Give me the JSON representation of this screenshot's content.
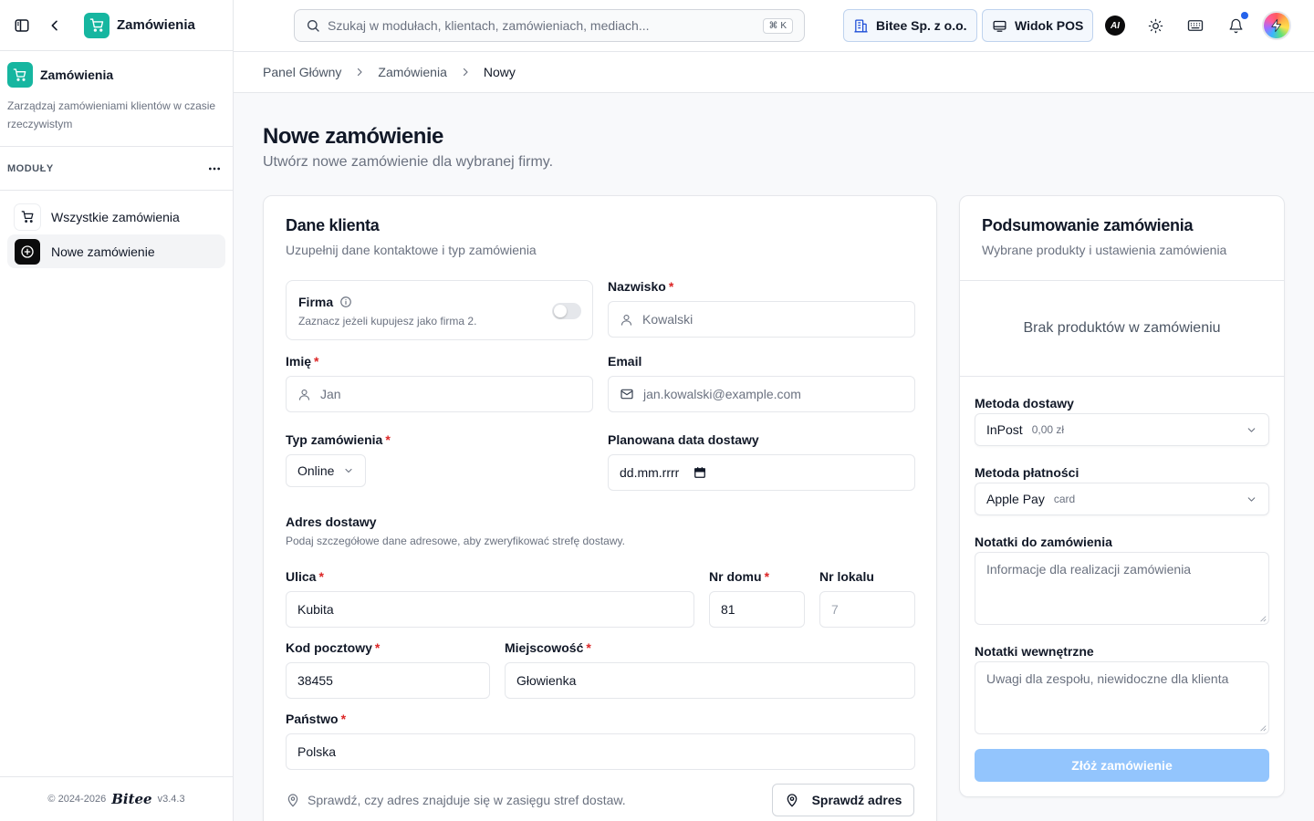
{
  "sidebar": {
    "app_title": "Zamówienia",
    "module_name": "Zamówienia",
    "module_desc": "Zarządzaj zamówieniami klientów w czasie rzeczywistym",
    "section_label": "MODUŁY",
    "items": [
      {
        "label": "Wszystkie zamówienia",
        "active": false
      },
      {
        "label": "Nowe zamówienie",
        "active": true
      }
    ],
    "footer_copyright": "© 2024-2026",
    "footer_brand": "Bitee",
    "footer_version": "v3.4.3"
  },
  "header": {
    "search_placeholder": "Szukaj w modułach, klientach, zamówieniach, mediach...",
    "search_shortcut": "⌘ K",
    "company_button": "Bitee Sp. z o.o.",
    "pos_button": "Widok POS",
    "ai_label": "AI"
  },
  "breadcrumb": [
    "Panel Główny",
    "Zamówienia",
    "Nowy"
  ],
  "page": {
    "title": "Nowe zamówienie",
    "subtitle": "Utwórz nowe zamówienie dla wybranej firmy."
  },
  "customer": {
    "title": "Dane klienta",
    "subtitle": "Uzupełnij dane kontaktowe i typ zamówienia",
    "firma_label": "Firma",
    "firma_desc": "Zaznacz jeżeli kupujesz jako firma 2.",
    "surname_label": "Nazwisko",
    "surname_placeholder": "Kowalski",
    "name_label": "Imię",
    "name_placeholder": "Jan",
    "email_label": "Email",
    "email_placeholder": "jan.kowalski@example.com",
    "order_type_label": "Typ zamówienia",
    "order_type_value": "Online",
    "delivery_date_label": "Planowana data dostawy",
    "delivery_date_value": "dd.mm.rrrr",
    "address_title": "Adres dostawy",
    "address_subtitle": "Podaj szczegółowe dane adresowe, aby zweryfikować strefę dostawy.",
    "street_label": "Ulica",
    "street_value": "Kubita",
    "house_label": "Nr domu",
    "house_value": "81",
    "flat_label": "Nr lokalu",
    "flat_placeholder": "7",
    "postal_label": "Kod pocztowy",
    "postal_value": "38455",
    "city_label": "Miejscowość",
    "city_value": "Głowienka",
    "country_label": "Państwo",
    "country_value": "Polska",
    "check_text": "Sprawdź, czy adres znajduje się w zasięgu stref dostaw.",
    "check_button": "Sprawdź adres"
  },
  "summary": {
    "title": "Podsumowanie zamówienia",
    "subtitle": "Wybrane produkty i ustawienia zamówienia",
    "empty_text": "Brak produktów w zamówieniu",
    "shipping_label": "Metoda dostawy",
    "shipping_value": "InPost",
    "shipping_price": "0,00 zł",
    "payment_label": "Metoda płatności",
    "payment_value": "Apple Pay",
    "payment_meta": "card",
    "notes_label": "Notatki do zamówienia",
    "notes_placeholder": "Informacje dla realizacji zamówienia",
    "internal_label": "Notatki wewnętrzne",
    "internal_placeholder": "Uwagi dla zespołu, niewidoczne dla klienta",
    "submit_label": "Złóż zamówienie"
  },
  "colors": {
    "brand": "#16b6a0",
    "submit_disabled": "#93c5fd",
    "notification_dot": "#2563eb",
    "required": "#dc2626"
  }
}
